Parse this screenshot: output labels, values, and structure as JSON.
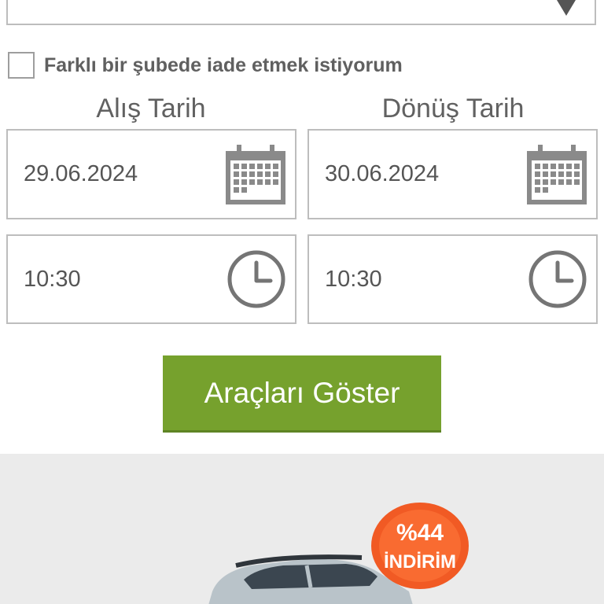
{
  "return_branch": {
    "checkbox_label": "Farklı bir şubede iade etmek istiyorum",
    "checked": false
  },
  "pickup": {
    "heading": "Alış Tarih",
    "date": "29.06.2024",
    "time": "10:30"
  },
  "return": {
    "heading": "Dönüş Tarih",
    "date": "30.06.2024",
    "time": "10:30"
  },
  "actions": {
    "show_cars_label": "Araçları Göster"
  },
  "promo": {
    "discount_label": "%44",
    "discount_word": "İNDİRİM"
  },
  "icons": {
    "date": "calendar-icon",
    "time": "clock-icon",
    "select": "dropdown-arrow-icon"
  },
  "colors": {
    "button": "#76a12d",
    "badge": "#f15a24",
    "border": "#bdbdbd",
    "banner_bg": "#ebebeb"
  }
}
